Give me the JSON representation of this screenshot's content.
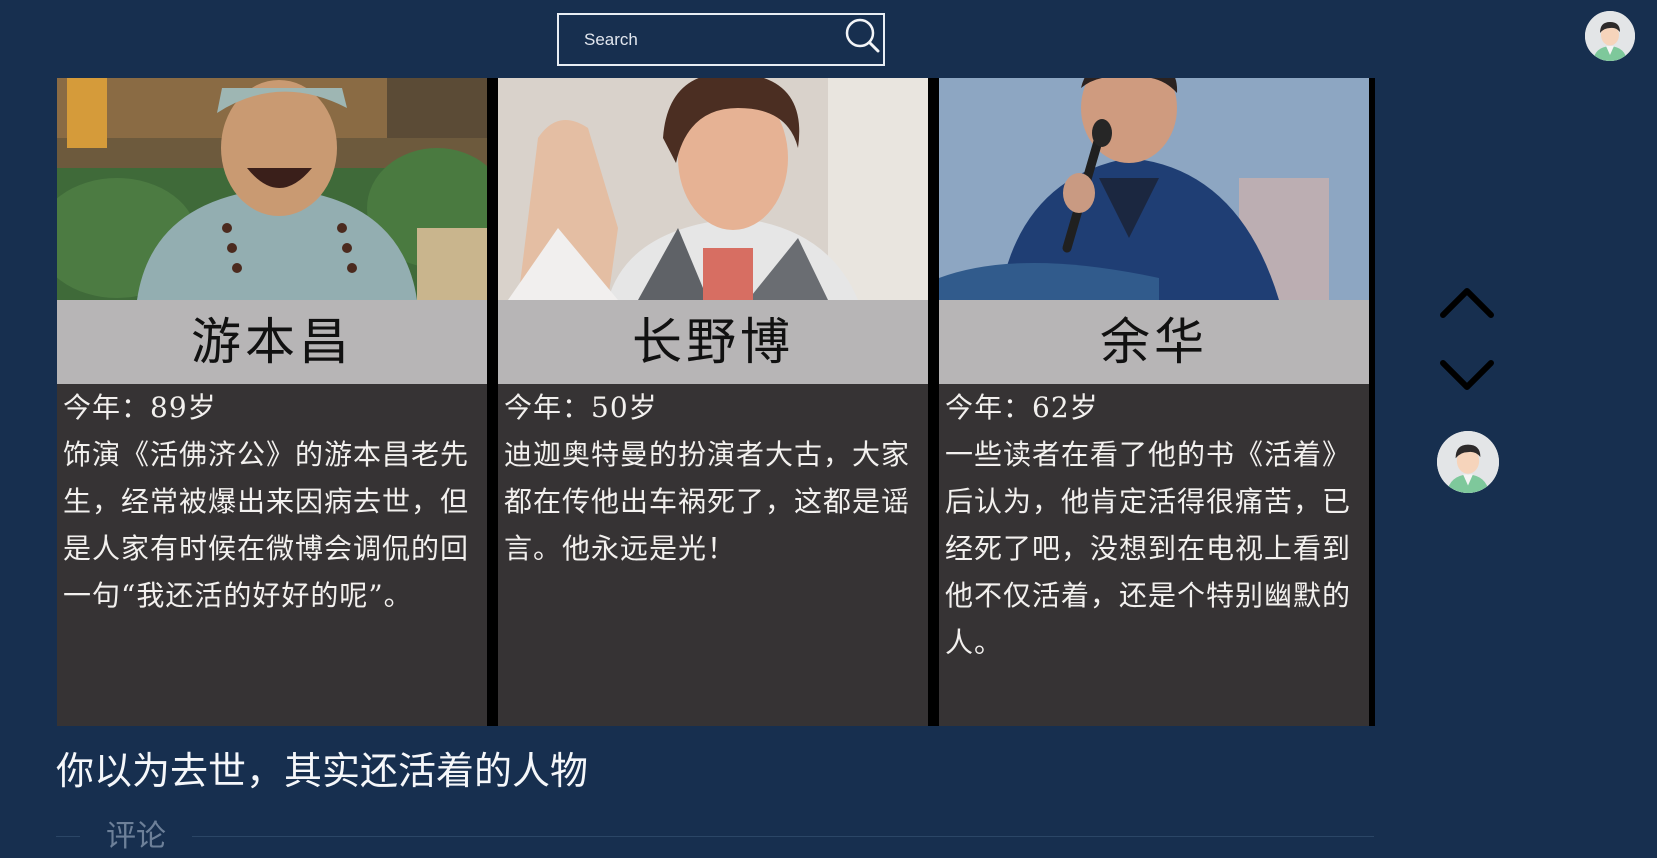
{
  "header": {
    "search": {
      "placeholder": "Search",
      "value": ""
    }
  },
  "icons": {
    "search": "search-icon",
    "avatar": "user-avatar",
    "up": "chevron-up-icon",
    "down": "chevron-down-icon"
  },
  "colors": {
    "background": "#172f4f",
    "card": "#363334",
    "name_band": "#b7b5b6"
  },
  "video": {
    "cards": [
      {
        "name": "游本昌",
        "age": "今年：89岁",
        "description": "饰演《活佛济公》的游本昌老先生，经常被爆出来因病去世，但是人家有时候在微博会调侃的回一句“我还活的好好的呢”。"
      },
      {
        "name": "长野博",
        "age": "今年：50岁",
        "description": "迪迦奥特曼的扮演者大古，大家都在传他出车祸死了，这都是谣言。他永远是光！"
      },
      {
        "name": "余华",
        "age": "今年：62岁",
        "description": "一些读者在看了他的书《活着》后认为，他肯定活得很痛苦，已经死了吧，没想到在电视上看到他不仅活着，还是个特别幽默的人。"
      }
    ],
    "title": "你以为去世，其实还活着的人物"
  },
  "comments": {
    "label": "评论"
  }
}
